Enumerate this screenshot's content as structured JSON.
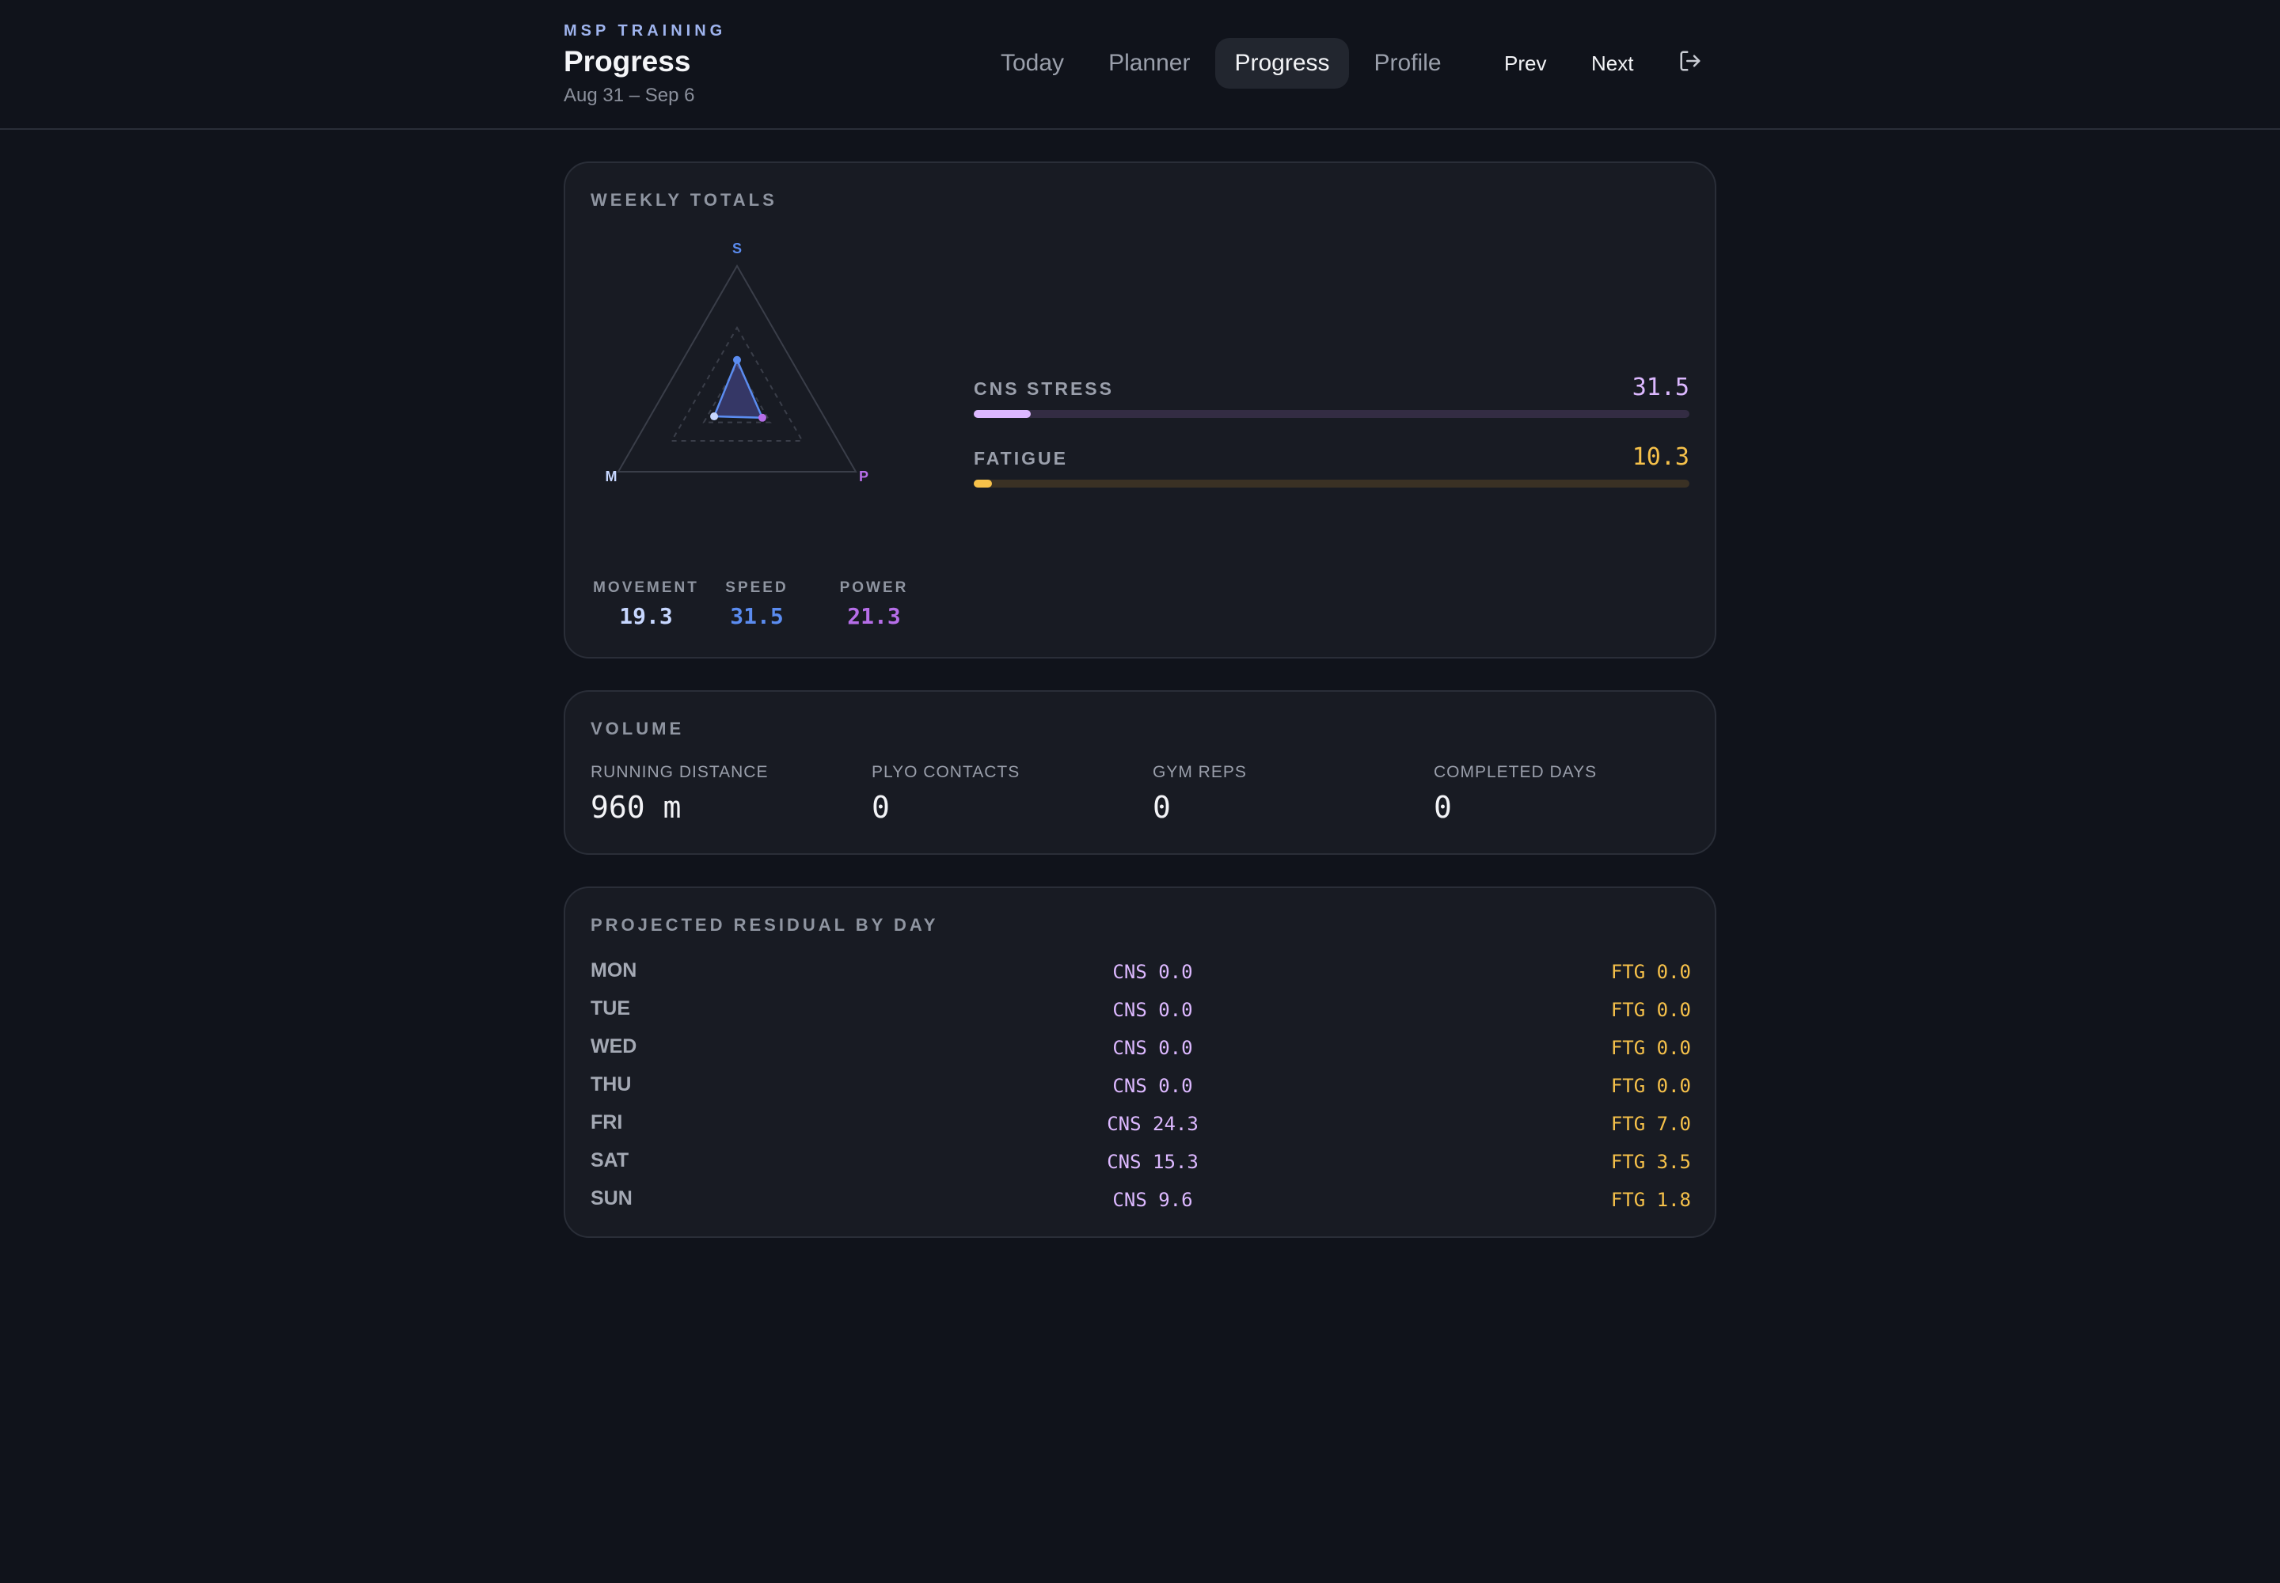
{
  "header": {
    "kicker": "MSP TRAINING",
    "title": "Progress",
    "date_range": "Aug 31 – Sep 6",
    "tabs": [
      {
        "label": "Today",
        "active": false
      },
      {
        "label": "Planner",
        "active": false
      },
      {
        "label": "Progress",
        "active": true
      },
      {
        "label": "Profile",
        "active": false
      }
    ],
    "prev_label": "Prev",
    "next_label": "Next",
    "logout_icon": "logout-icon"
  },
  "weekly": {
    "title": "WEEKLY TOTALS",
    "radar": {
      "axis_labels": {
        "speed": "S",
        "movement": "M",
        "power": "P"
      },
      "max": 100
    },
    "stats": [
      {
        "label": "MOVEMENT",
        "value": "19.3",
        "color": "#c7d7ff"
      },
      {
        "label": "SPEED",
        "value": "31.5",
        "color": "#5b8cf0"
      },
      {
        "label": "POWER",
        "value": "21.3",
        "color": "#b66ee8"
      }
    ],
    "meters": [
      {
        "label": "CNS STRESS",
        "value": "31.5",
        "fraction": 0.08,
        "color": "#dcb8ff",
        "track": "#332c43"
      },
      {
        "label": "FATIGUE",
        "value": "10.3",
        "fraction": 0.025,
        "color": "#f6c14a",
        "track": "#3a3124"
      }
    ]
  },
  "volume": {
    "title": "VOLUME",
    "items": [
      {
        "label": "RUNNING DISTANCE",
        "value": "960 m"
      },
      {
        "label": "PLYO CONTACTS",
        "value": "0"
      },
      {
        "label": "GYM REPS",
        "value": "0"
      },
      {
        "label": "COMPLETED DAYS",
        "value": "0"
      }
    ]
  },
  "residual": {
    "title": "PROJECTED RESIDUAL BY DAY",
    "rows": [
      {
        "day": "MON",
        "cns": "CNS 0.0",
        "ftg": "FTG 0.0"
      },
      {
        "day": "TUE",
        "cns": "CNS 0.0",
        "ftg": "FTG 0.0"
      },
      {
        "day": "WED",
        "cns": "CNS 0.0",
        "ftg": "FTG 0.0"
      },
      {
        "day": "THU",
        "cns": "CNS 0.0",
        "ftg": "FTG 0.0"
      },
      {
        "day": "FRI",
        "cns": "CNS 24.3",
        "ftg": "FTG 7.0"
      },
      {
        "day": "SAT",
        "cns": "CNS 15.3",
        "ftg": "FTG 3.5"
      },
      {
        "day": "SUN",
        "cns": "CNS 9.6",
        "ftg": "FTG 1.8"
      }
    ]
  }
}
